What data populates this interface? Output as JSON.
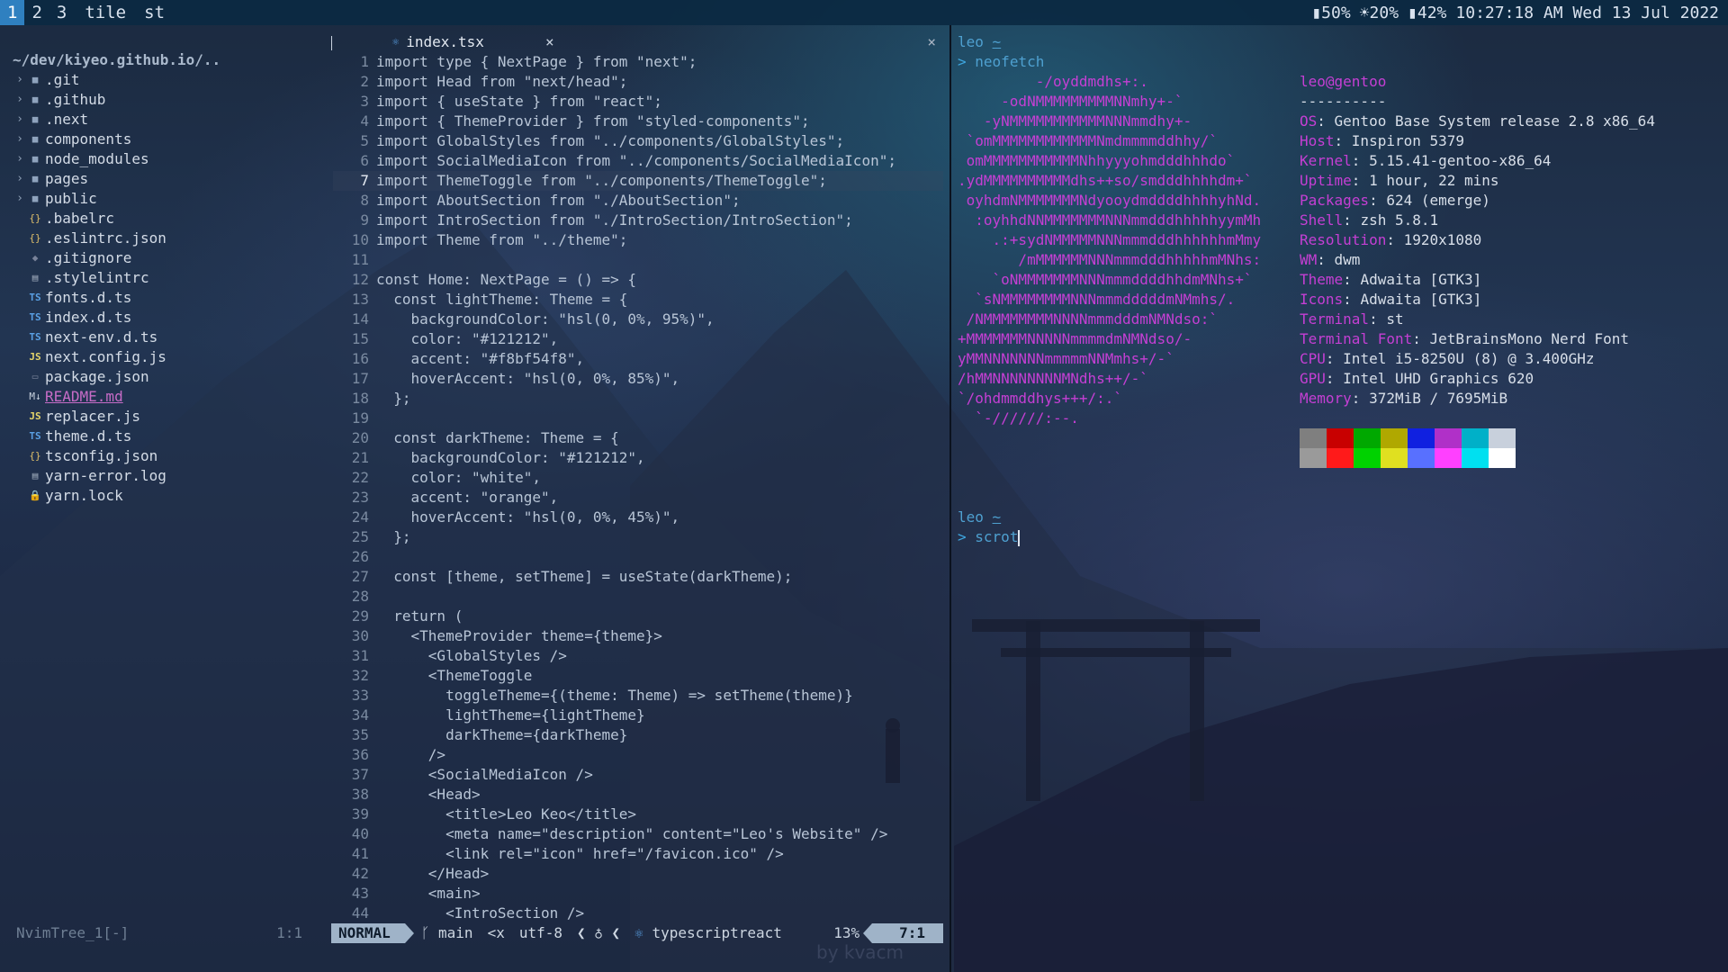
{
  "topbar": {
    "workspaces": [
      "1",
      "2",
      "3"
    ],
    "layout": "tile",
    "window_title": "st",
    "status": {
      "battery": "50%",
      "brightness": "20%",
      "storage": "42%",
      "datetime": "10:27:18 AM Wed 13 Jul 2022"
    }
  },
  "filetree": {
    "root": "~/dev/kiyeo.github.io/..",
    "folders": [
      ".git",
      ".github",
      ".next",
      "components",
      "node_modules",
      "pages",
      "public"
    ],
    "files": [
      {
        "name": ".babelrc",
        "icon": "braces-icon"
      },
      {
        "name": ".eslintrc.json",
        "icon": "braces-icon"
      },
      {
        "name": ".gitignore",
        "icon": "git-icon"
      },
      {
        "name": ".stylelintrc",
        "icon": "file-icon"
      },
      {
        "name": "fonts.d.ts",
        "icon": "ts-icon"
      },
      {
        "name": "index.d.ts",
        "icon": "ts-icon"
      },
      {
        "name": "next-env.d.ts",
        "icon": "ts-icon"
      },
      {
        "name": "next.config.js",
        "icon": "js-icon"
      },
      {
        "name": "package.json",
        "icon": "npm-icon"
      },
      {
        "name": "README.md",
        "icon": "md-icon"
      },
      {
        "name": "replacer.js",
        "icon": "js-icon"
      },
      {
        "name": "theme.d.ts",
        "icon": "ts-icon"
      },
      {
        "name": "tsconfig.json",
        "icon": "braces-icon"
      },
      {
        "name": "yarn-error.log",
        "icon": "log-icon"
      },
      {
        "name": "yarn.lock",
        "icon": "lock-icon"
      }
    ],
    "status_left": "NvimTree_1[-]",
    "status_right": "1:1"
  },
  "editor": {
    "tab_name": "index.tsx",
    "tab_close": "×",
    "close_all": "×",
    "current_line": 7,
    "lines": [
      "import type { NextPage } from \"next\";",
      "import Head from \"next/head\";",
      "import { useState } from \"react\";",
      "import { ThemeProvider } from \"styled-components\";",
      "import GlobalStyles from \"../components/GlobalStyles\";",
      "import SocialMediaIcon from \"../components/SocialMediaIcon\";",
      "import ThemeToggle from \"../components/ThemeToggle\";",
      "import AboutSection from \"./AboutSection\";",
      "import IntroSection from \"./IntroSection/IntroSection\";",
      "import Theme from \"../theme\";",
      "",
      "const Home: NextPage = () => {",
      "  const lightTheme: Theme = {",
      "    backgroundColor: \"hsl(0, 0%, 95%)\",",
      "    color: \"#121212\",",
      "    accent: \"#f8bf54f8\",",
      "    hoverAccent: \"hsl(0, 0%, 85%)\",",
      "  };",
      "",
      "  const darkTheme: Theme = {",
      "    backgroundColor: \"#121212\",",
      "    color: \"white\",",
      "    accent: \"orange\",",
      "    hoverAccent: \"hsl(0, 0%, 45%)\",",
      "  };",
      "",
      "  const [theme, setTheme] = useState(darkTheme);",
      "",
      "  return (",
      "    <ThemeProvider theme={theme}>",
      "      <GlobalStyles />",
      "      <ThemeToggle",
      "        toggleTheme={(theme: Theme) => setTheme(theme)}",
      "        lightTheme={lightTheme}",
      "        darkTheme={darkTheme}",
      "      />",
      "      <SocialMediaIcon />",
      "      <Head>",
      "        <title>Leo Keo</title>",
      "        <meta name=\"description\" content=\"Leo's Website\" />",
      "        <link rel=\"icon\" href=\"/favicon.ico\" />",
      "      </Head>",
      "      <main>",
      "        <IntroSection />"
    ],
    "statusline": {
      "mode": "NORMAL",
      "branch": "main",
      "format": "<x",
      "encoding": "utf-8",
      "filetype": "typescriptreact",
      "percent": "13%",
      "position": "7:1"
    }
  },
  "watermark": "by kvacm",
  "terminal": {
    "user": "leo",
    "dir": "~",
    "prompt_symbol": ">",
    "command1": "neofetch",
    "command2": "scrot",
    "neofetch_title": "leo@gentoo",
    "neofetch_separator": "----------",
    "info": [
      {
        "key": "OS",
        "value": "Gentoo Base System release 2.8 x86_64"
      },
      {
        "key": "Host",
        "value": "Inspiron 5379"
      },
      {
        "key": "Kernel",
        "value": "5.15.41-gentoo-x86_64"
      },
      {
        "key": "Uptime",
        "value": "1 hour, 22 mins"
      },
      {
        "key": "Packages",
        "value": "624 (emerge)"
      },
      {
        "key": "Shell",
        "value": "zsh 5.8.1"
      },
      {
        "key": "Resolution",
        "value": "1920x1080"
      },
      {
        "key": "WM",
        "value": "dwm"
      },
      {
        "key": "Theme",
        "value": "Adwaita [GTK3]"
      },
      {
        "key": "Icons",
        "value": "Adwaita [GTK3]"
      },
      {
        "key": "Terminal",
        "value": "st"
      },
      {
        "key": "Terminal Font",
        "value": "JetBrainsMono Nerd Font"
      },
      {
        "key": "CPU",
        "value": "Intel i5-8250U (8) @ 3.400GHz"
      },
      {
        "key": "GPU",
        "value": "Intel UHD Graphics 620"
      },
      {
        "key": "Memory",
        "value": "372MiB / 7695MiB"
      }
    ],
    "ascii_art": [
      "         -/oyddmdhs+:.",
      "     -odNMMMMMMMMMNNmhy+-`",
      "   -yNMMMMMMMMMMMNNNmmdhy+-",
      " `omMMMMMMMMMMMMNmdmmmmddhhy/`",
      " omMMMMMMMMMMMNhhyyyohmdddhhhdo`",
      ".ydMMMMMMMMMMdhs++so/smdddhhhhdm+`",
      " oyhdmNMMMMMMMNdyooydmddddhhhhyhNd.",
      "  :oyhhdNNMMMMMMMNNNmmdddhhhhhyymMh",
      "    .:+sydNMMMMMNNNmmmdddhhhhhhmMmy",
      "       /mMMMMMMNNNmmmdddhhhhhmMNhs:",
      "    `oNMMMMMMMNNNmmmddddhhdmMNhs+`",
      "  `sNMMMMMMMMNNNmmmdddddmNMmhs/.",
      " /NMMMMMMMMNNNNmmmdddmNMNdso:`",
      "+MMMMMMMNNNNNmmmmdmNMNdso/-",
      "yMMNNNNNNNmmmmmNNMmhs+/-`",
      "/hMMNNNNNNNNMNdhs++/-`",
      "`/ohdmmddhys+++/:.`",
      "  `-//////:--."
    ],
    "palette": [
      "#7f7f7f",
      "#c80000",
      "#00a800",
      "#b0a800",
      "#1020e0",
      "#b030c8",
      "#00b0c8",
      "#c8d0dc",
      "#9a9a9a",
      "#ff1a1a",
      "#00d200",
      "#e0e020",
      "#5870ff",
      "#ff40ff",
      "#00e0f0",
      "#ffffff"
    ]
  }
}
